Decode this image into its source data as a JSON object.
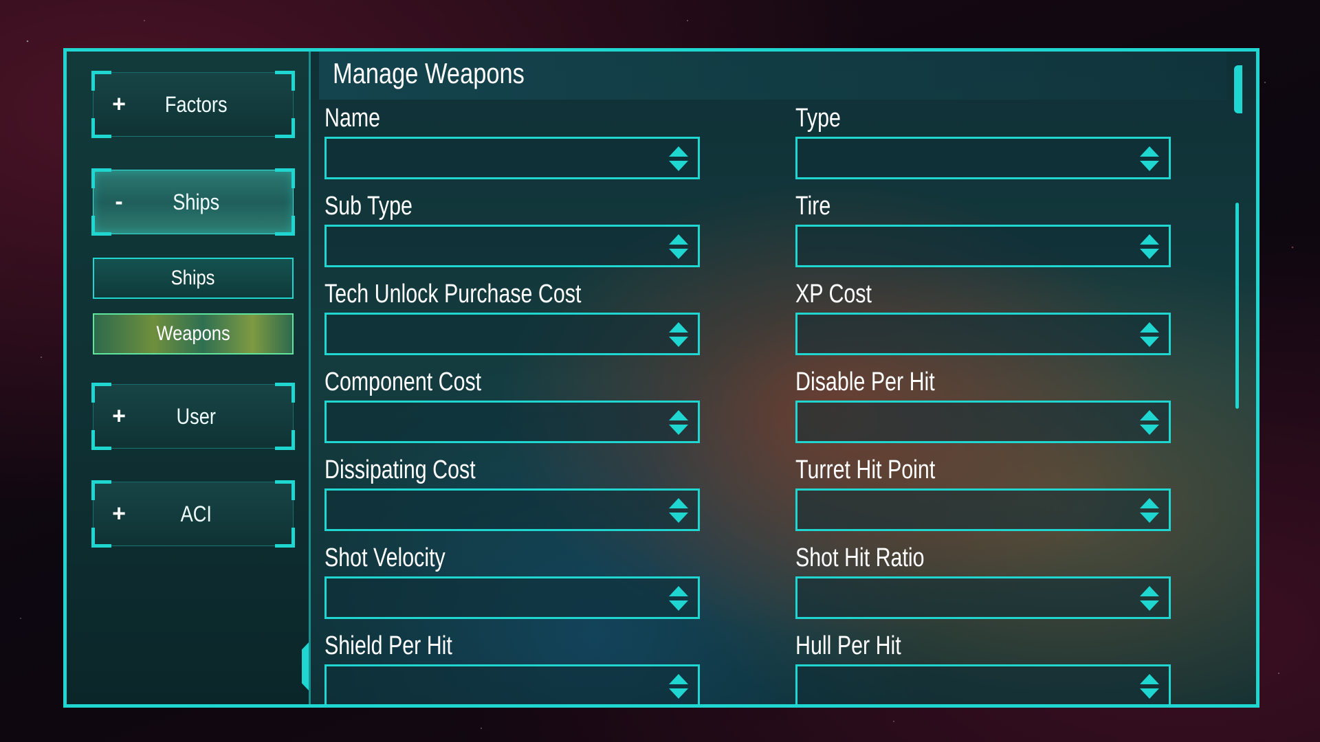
{
  "sidebar": {
    "groups": [
      {
        "icon": "+",
        "label": "Factors"
      },
      {
        "icon": "-",
        "label": "Ships"
      },
      {
        "icon": "+",
        "label": "User"
      },
      {
        "icon": "+",
        "label": "ACI"
      }
    ],
    "sub_items": [
      {
        "label": "Ships"
      },
      {
        "label": "Weapons"
      }
    ]
  },
  "main": {
    "title": "Manage Weapons",
    "fields": [
      {
        "label": "Name",
        "value": ""
      },
      {
        "label": "Type",
        "value": ""
      },
      {
        "label": "Sub Type",
        "value": ""
      },
      {
        "label": "Tire",
        "value": ""
      },
      {
        "label": "Tech Unlock Purchase Cost",
        "value": ""
      },
      {
        "label": "XP Cost",
        "value": ""
      },
      {
        "label": "Component Cost",
        "value": ""
      },
      {
        "label": "Disable Per Hit",
        "value": ""
      },
      {
        "label": "Dissipating Cost",
        "value": ""
      },
      {
        "label": "Turret Hit Point",
        "value": ""
      },
      {
        "label": "Shot Velocity",
        "value": ""
      },
      {
        "label": "Shot Hit Ratio",
        "value": ""
      },
      {
        "label": "Shield Per Hit",
        "value": ""
      },
      {
        "label": "Hull Per Hit",
        "value": ""
      }
    ]
  },
  "colors": {
    "accent": "#1fd6d0",
    "selected_item": "#5fe59d"
  }
}
